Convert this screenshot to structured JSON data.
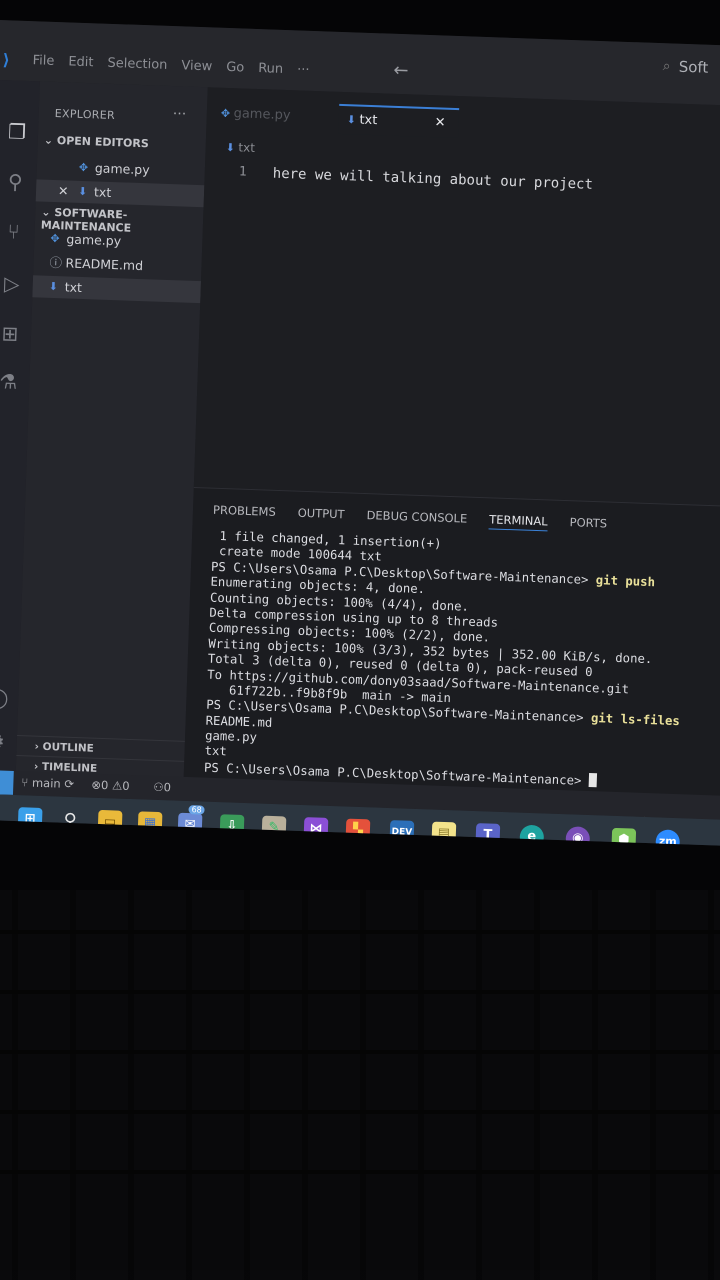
{
  "titlebar": {
    "menu": [
      "File",
      "Edit",
      "Selection",
      "View",
      "Go",
      "Run",
      "···"
    ],
    "title_fragment": "Soft"
  },
  "sidebar": {
    "header": "EXPLORER",
    "more": "···",
    "open_editors_label": "OPEN EDITORS",
    "open_editors": [
      {
        "name": "game.py",
        "icon": "python-icon"
      },
      {
        "name": "txt",
        "icon": "text-file-icon",
        "close": "✕"
      }
    ],
    "folder_label": "SOFTWARE-MAINTENANCE",
    "files": [
      {
        "name": "game.py",
        "icon": "python-icon"
      },
      {
        "name": "README.md",
        "icon": "info-icon"
      },
      {
        "name": "txt",
        "icon": "text-file-icon"
      }
    ],
    "outline_label": "OUTLINE",
    "timeline_label": "TIMELINE"
  },
  "editor": {
    "tabs": [
      {
        "label": "game.py"
      },
      {
        "label": "txt",
        "close": "✕"
      }
    ],
    "breadcrumb": "txt",
    "lines": [
      {
        "num": "1",
        "text": "here we will talking about our project"
      }
    ]
  },
  "panel": {
    "tabs": [
      "PROBLEMS",
      "OUTPUT",
      "DEBUG CONSOLE",
      "TERMINAL",
      "PORTS"
    ],
    "active_tab": "TERMINAL",
    "terminal": [
      {
        "text": " 1 file changed, 1 insertion(+)"
      },
      {
        "text": " create mode 100644 txt"
      },
      {
        "prompt": "PS C:\\Users\\Osama P.C\\Desktop\\Software-Maintenance> ",
        "cmd": "git push"
      },
      {
        "text": "Enumerating objects: 4, done."
      },
      {
        "text": "Counting objects: 100% (4/4), done."
      },
      {
        "text": "Delta compression using up to 8 threads"
      },
      {
        "text": "Compressing objects: 100% (2/2), done."
      },
      {
        "text": "Writing objects: 100% (3/3), 352 bytes | 352.00 KiB/s, done."
      },
      {
        "text": "Total 3 (delta 0), reused 0 (delta 0), pack-reused 0"
      },
      {
        "text": "To https://github.com/dony03saad/Software-Maintenance.git"
      },
      {
        "text": "   61f722b..f9b8f9b  main -> main"
      },
      {
        "prompt": "PS C:\\Users\\Osama P.C\\Desktop\\Software-Maintenance> ",
        "cmd": "git ls-files"
      },
      {
        "text": "README.md"
      },
      {
        "text": "game.py"
      },
      {
        "text": "txt"
      },
      {
        "prompt": "PS C:\\Users\\Osama P.C\\Desktop\\Software-Maintenance> ",
        "cmd": ""
      }
    ]
  },
  "statusbar": {
    "remote": "✕",
    "branch": "main",
    "errors": "0",
    "warnings": "0",
    "ports": "0"
  },
  "taskbar": {
    "mail_badge": "68",
    "zoom_label": "zm",
    "apps": [
      "windows-start-icon",
      "search-icon",
      "file-explorer-icon",
      "store-icon",
      "mail-icon",
      "app-installer-icon",
      "paint-icon",
      "visual-studio-icon",
      "office-icon",
      "devhome-icon",
      "notes-icon",
      "teams-icon",
      "edge-icon",
      "github-desktop-icon",
      "cube-icon",
      "zoom-icon"
    ]
  },
  "colors": {
    "accent": "#3b82d8",
    "git_cmd": "#e9e09a",
    "background": "#1e1f24"
  }
}
